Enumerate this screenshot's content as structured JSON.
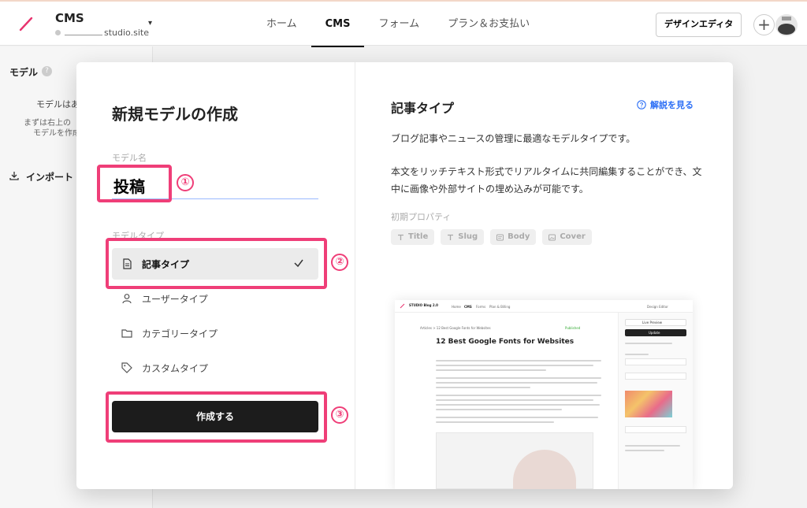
{
  "header": {
    "site_name": "CMS",
    "site_url": "studio.site",
    "tabs": [
      "ホーム",
      "CMS",
      "フォーム",
      "プラン＆お支払い"
    ],
    "active_tab": "CMS",
    "design_editor": "デザインエディタ",
    "plus": "+"
  },
  "sidebar": {
    "title": "モデル",
    "help": "?",
    "empty": "モデルはあ",
    "note_1": "まずは右上の",
    "note_2": "モデルを作成",
    "import": "インポート"
  },
  "modal": {
    "title": "新規モデルの作成",
    "name_label": "モデル名",
    "name_value": "投稿",
    "type_label": "モデルタイプ",
    "types": [
      {
        "label": "記事タイプ",
        "selected": true,
        "icon": "document-icon"
      },
      {
        "label": "ユーザータイプ",
        "selected": false,
        "icon": "user-icon"
      },
      {
        "label": "カテゴリータイプ",
        "selected": false,
        "icon": "folder-icon"
      },
      {
        "label": "カスタムタイプ",
        "selected": false,
        "icon": "tag-icon"
      }
    ],
    "create_button": "作成する",
    "annotations": [
      "①",
      "②",
      "③"
    ]
  },
  "detail": {
    "title": "記事タイプ",
    "help_link": "解説を見る",
    "desc_1": "ブログ記事やニュースの管理に最適なモデルタイプです。",
    "desc_2": "本文をリッチテキスト形式でリアルタイムに共同編集することができ、文中に画像や外部サイトの埋め込みが可能です。",
    "props_label": "初期プロパティ",
    "props": [
      "Title",
      "Slug",
      "Body",
      "Cover"
    ]
  },
  "preview": {
    "blog_name": "STUDIO Blog 2.0",
    "tabs": [
      "Home",
      "CMS",
      "Forms",
      "Plan & Billing"
    ],
    "design_editor": "Design Editor",
    "breadcrumb": "Articles  >  12 Best Google Fonts for Websites",
    "status": "Published",
    "heading": "12 Best Google Fonts for Websites",
    "live_preview": "Live Preview",
    "update": "Update"
  },
  "colors": {
    "accent": "#ef3e78",
    "link": "#2b6ef5",
    "button": "#1c1c1c"
  }
}
